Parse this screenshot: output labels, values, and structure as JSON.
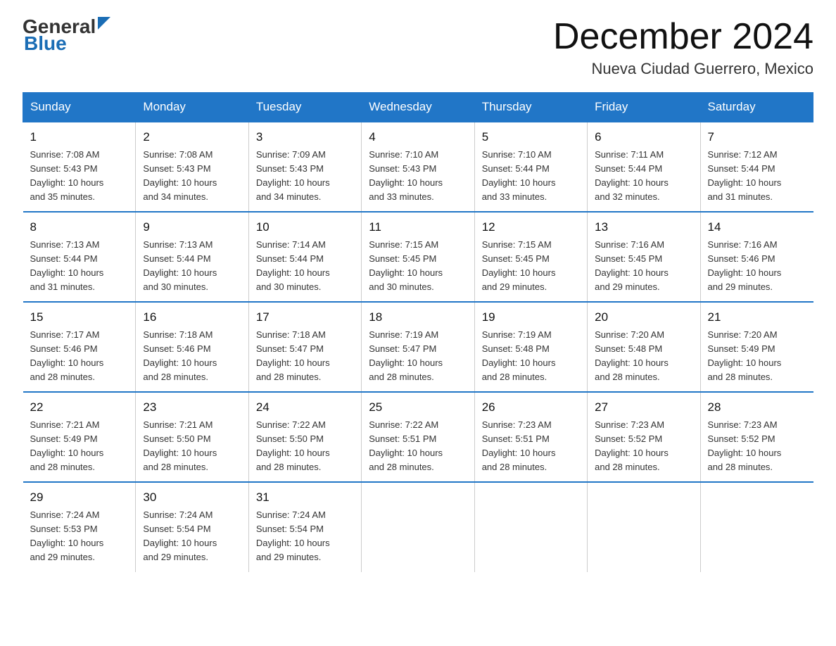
{
  "header": {
    "logo_general": "General",
    "logo_blue": "Blue",
    "title": "December 2024",
    "subtitle": "Nueva Ciudad Guerrero, Mexico"
  },
  "days_of_week": [
    "Sunday",
    "Monday",
    "Tuesday",
    "Wednesday",
    "Thursday",
    "Friday",
    "Saturday"
  ],
  "weeks": [
    [
      {
        "day": "1",
        "sunrise": "7:08 AM",
        "sunset": "5:43 PM",
        "daylight": "10 hours and 35 minutes."
      },
      {
        "day": "2",
        "sunrise": "7:08 AM",
        "sunset": "5:43 PM",
        "daylight": "10 hours and 34 minutes."
      },
      {
        "day": "3",
        "sunrise": "7:09 AM",
        "sunset": "5:43 PM",
        "daylight": "10 hours and 34 minutes."
      },
      {
        "day": "4",
        "sunrise": "7:10 AM",
        "sunset": "5:43 PM",
        "daylight": "10 hours and 33 minutes."
      },
      {
        "day": "5",
        "sunrise": "7:10 AM",
        "sunset": "5:44 PM",
        "daylight": "10 hours and 33 minutes."
      },
      {
        "day": "6",
        "sunrise": "7:11 AM",
        "sunset": "5:44 PM",
        "daylight": "10 hours and 32 minutes."
      },
      {
        "day": "7",
        "sunrise": "7:12 AM",
        "sunset": "5:44 PM",
        "daylight": "10 hours and 31 minutes."
      }
    ],
    [
      {
        "day": "8",
        "sunrise": "7:13 AM",
        "sunset": "5:44 PM",
        "daylight": "10 hours and 31 minutes."
      },
      {
        "day": "9",
        "sunrise": "7:13 AM",
        "sunset": "5:44 PM",
        "daylight": "10 hours and 30 minutes."
      },
      {
        "day": "10",
        "sunrise": "7:14 AM",
        "sunset": "5:44 PM",
        "daylight": "10 hours and 30 minutes."
      },
      {
        "day": "11",
        "sunrise": "7:15 AM",
        "sunset": "5:45 PM",
        "daylight": "10 hours and 30 minutes."
      },
      {
        "day": "12",
        "sunrise": "7:15 AM",
        "sunset": "5:45 PM",
        "daylight": "10 hours and 29 minutes."
      },
      {
        "day": "13",
        "sunrise": "7:16 AM",
        "sunset": "5:45 PM",
        "daylight": "10 hours and 29 minutes."
      },
      {
        "day": "14",
        "sunrise": "7:16 AM",
        "sunset": "5:46 PM",
        "daylight": "10 hours and 29 minutes."
      }
    ],
    [
      {
        "day": "15",
        "sunrise": "7:17 AM",
        "sunset": "5:46 PM",
        "daylight": "10 hours and 28 minutes."
      },
      {
        "day": "16",
        "sunrise": "7:18 AM",
        "sunset": "5:46 PM",
        "daylight": "10 hours and 28 minutes."
      },
      {
        "day": "17",
        "sunrise": "7:18 AM",
        "sunset": "5:47 PM",
        "daylight": "10 hours and 28 minutes."
      },
      {
        "day": "18",
        "sunrise": "7:19 AM",
        "sunset": "5:47 PM",
        "daylight": "10 hours and 28 minutes."
      },
      {
        "day": "19",
        "sunrise": "7:19 AM",
        "sunset": "5:48 PM",
        "daylight": "10 hours and 28 minutes."
      },
      {
        "day": "20",
        "sunrise": "7:20 AM",
        "sunset": "5:48 PM",
        "daylight": "10 hours and 28 minutes."
      },
      {
        "day": "21",
        "sunrise": "7:20 AM",
        "sunset": "5:49 PM",
        "daylight": "10 hours and 28 minutes."
      }
    ],
    [
      {
        "day": "22",
        "sunrise": "7:21 AM",
        "sunset": "5:49 PM",
        "daylight": "10 hours and 28 minutes."
      },
      {
        "day": "23",
        "sunrise": "7:21 AM",
        "sunset": "5:50 PM",
        "daylight": "10 hours and 28 minutes."
      },
      {
        "day": "24",
        "sunrise": "7:22 AM",
        "sunset": "5:50 PM",
        "daylight": "10 hours and 28 minutes."
      },
      {
        "day": "25",
        "sunrise": "7:22 AM",
        "sunset": "5:51 PM",
        "daylight": "10 hours and 28 minutes."
      },
      {
        "day": "26",
        "sunrise": "7:23 AM",
        "sunset": "5:51 PM",
        "daylight": "10 hours and 28 minutes."
      },
      {
        "day": "27",
        "sunrise": "7:23 AM",
        "sunset": "5:52 PM",
        "daylight": "10 hours and 28 minutes."
      },
      {
        "day": "28",
        "sunrise": "7:23 AM",
        "sunset": "5:52 PM",
        "daylight": "10 hours and 28 minutes."
      }
    ],
    [
      {
        "day": "29",
        "sunrise": "7:24 AM",
        "sunset": "5:53 PM",
        "daylight": "10 hours and 29 minutes."
      },
      {
        "day": "30",
        "sunrise": "7:24 AM",
        "sunset": "5:54 PM",
        "daylight": "10 hours and 29 minutes."
      },
      {
        "day": "31",
        "sunrise": "7:24 AM",
        "sunset": "5:54 PM",
        "daylight": "10 hours and 29 minutes."
      },
      null,
      null,
      null,
      null
    ]
  ],
  "labels": {
    "sunrise": "Sunrise:",
    "sunset": "Sunset:",
    "daylight": "Daylight:"
  }
}
